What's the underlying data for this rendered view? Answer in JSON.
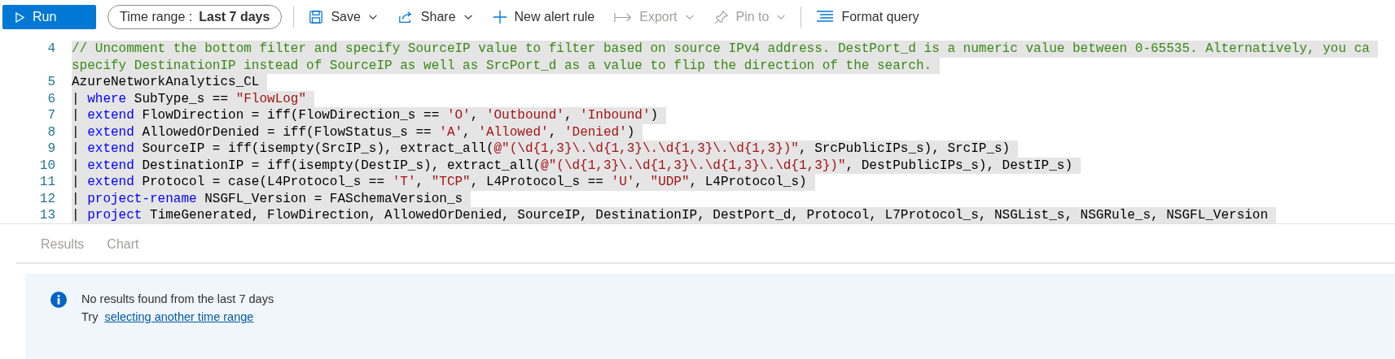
{
  "toolbar": {
    "run_button": {
      "label": "Run"
    },
    "time_range": {
      "label": "Time range :",
      "value": "Last 7 days"
    },
    "actions": [
      {
        "label": "Save",
        "kind": "save",
        "dropdown": true,
        "disabled": false
      },
      {
        "label": "Share",
        "kind": "share",
        "dropdown": true,
        "disabled": false
      },
      {
        "label": "New alert rule",
        "kind": "alert",
        "dropdown": false,
        "disabled": false
      },
      {
        "label": "Export",
        "kind": "export",
        "dropdown": true,
        "disabled": true
      },
      {
        "label": "Pin to",
        "kind": "pin",
        "dropdown": true,
        "disabled": true
      },
      {
        "label": "Format query",
        "kind": "format",
        "dropdown": false,
        "disabled": false
      }
    ]
  },
  "editor": {
    "lines": [
      {
        "number": "4",
        "rows": [
          [
            {
              "kind": "comment",
              "text": "// Uncomment the bottom filter and specify SourceIP value to filter based on source IPv4 address. DestPort_d is a numeric value between 0-65535. Alternatively, you ca"
            }
          ],
          [
            {
              "kind": "comment",
              "text": "specify DestinationIP instead of SourceIP as well as SrcPort_d as a value to flip the direction of the search."
            }
          ]
        ]
      },
      {
        "number": "5",
        "rows": [
          [
            {
              "kind": "plain",
              "text": "AzureNetworkAnalytics_CL"
            }
          ]
        ]
      },
      {
        "number": "6",
        "rows": [
          [
            {
              "kind": "plain",
              "text": "| "
            },
            {
              "kind": "keyword",
              "text": "where"
            },
            {
              "kind": "plain",
              "text": " SubType_s == "
            },
            {
              "kind": "string",
              "text": "\"FlowLog\""
            }
          ]
        ]
      },
      {
        "number": "7",
        "rows": [
          [
            {
              "kind": "plain",
              "text": "| "
            },
            {
              "kind": "keyword",
              "text": "extend"
            },
            {
              "kind": "plain",
              "text": " FlowDirection = iff(FlowDirection_s == "
            },
            {
              "kind": "string",
              "text": "'O'"
            },
            {
              "kind": "plain",
              "text": ", "
            },
            {
              "kind": "string",
              "text": "'Outbound'"
            },
            {
              "kind": "plain",
              "text": ", "
            },
            {
              "kind": "string",
              "text": "'Inbound'"
            },
            {
              "kind": "plain",
              "text": ")"
            }
          ]
        ]
      },
      {
        "number": "8",
        "rows": [
          [
            {
              "kind": "plain",
              "text": "| "
            },
            {
              "kind": "keyword",
              "text": "extend"
            },
            {
              "kind": "plain",
              "text": " AllowedOrDenied = iff(FlowStatus_s == "
            },
            {
              "kind": "string",
              "text": "'A'"
            },
            {
              "kind": "plain",
              "text": ", "
            },
            {
              "kind": "string",
              "text": "'Allowed'"
            },
            {
              "kind": "plain",
              "text": ", "
            },
            {
              "kind": "string",
              "text": "'Denied'"
            },
            {
              "kind": "plain",
              "text": ")"
            }
          ]
        ]
      },
      {
        "number": "9",
        "rows": [
          [
            {
              "kind": "plain",
              "text": "| "
            },
            {
              "kind": "keyword",
              "text": "extend"
            },
            {
              "kind": "plain",
              "text": " SourceIP = iff(isempty(SrcIP_s), extract_all("
            },
            {
              "kind": "string",
              "text": "@\"(\\d{1,3}\\.\\d{1,3}\\.\\d{1,3}\\.\\d{1,3})\""
            },
            {
              "kind": "plain",
              "text": ", SrcPublicIPs_s), SrcIP_s)"
            }
          ]
        ]
      },
      {
        "number": "10",
        "rows": [
          [
            {
              "kind": "plain",
              "text": "| "
            },
            {
              "kind": "keyword",
              "text": "extend"
            },
            {
              "kind": "plain",
              "text": " DestinationIP = iff(isempty(DestIP_s), extract_all("
            },
            {
              "kind": "string",
              "text": "@\"(\\d{1,3}\\.\\d{1,3}\\.\\d{1,3}\\.\\d{1,3})\""
            },
            {
              "kind": "plain",
              "text": ", DestPublicIPs_s), DestIP_s)"
            }
          ]
        ]
      },
      {
        "number": "11",
        "rows": [
          [
            {
              "kind": "plain",
              "text": "| "
            },
            {
              "kind": "keyword",
              "text": "extend"
            },
            {
              "kind": "plain",
              "text": " Protocol = case(L4Protocol_s == "
            },
            {
              "kind": "string",
              "text": "'T'"
            },
            {
              "kind": "plain",
              "text": ", "
            },
            {
              "kind": "string",
              "text": "\"TCP\""
            },
            {
              "kind": "plain",
              "text": ", L4Protocol_s == "
            },
            {
              "kind": "string",
              "text": "'U'"
            },
            {
              "kind": "plain",
              "text": ", "
            },
            {
              "kind": "string",
              "text": "\"UDP\""
            },
            {
              "kind": "plain",
              "text": ", L4Protocol_s)"
            }
          ]
        ]
      },
      {
        "number": "12",
        "rows": [
          [
            {
              "kind": "plain",
              "text": "| "
            },
            {
              "kind": "keyword",
              "text": "project-rename"
            },
            {
              "kind": "plain",
              "text": " NSGFL_Version = FASchemaVersion_s"
            }
          ]
        ]
      },
      {
        "number": "13",
        "rows": [
          [
            {
              "kind": "plain",
              "text": "| "
            },
            {
              "kind": "keyword",
              "text": "project"
            },
            {
              "kind": "plain",
              "text": " TimeGenerated, FlowDirection, AllowedOrDenied, SourceIP, DestinationIP, DestPort_d, Protocol, L7Protocol_s, NSGList_s, NSGRule_s, NSGFL_Version"
            }
          ]
        ]
      }
    ]
  },
  "results": {
    "tabs": [
      {
        "label": "Results",
        "selected": false
      },
      {
        "label": "Chart",
        "selected": false
      }
    ],
    "message": {
      "title": "No results found from the last 7 days",
      "prefix": "Try",
      "link": "selecting another time range"
    }
  }
}
